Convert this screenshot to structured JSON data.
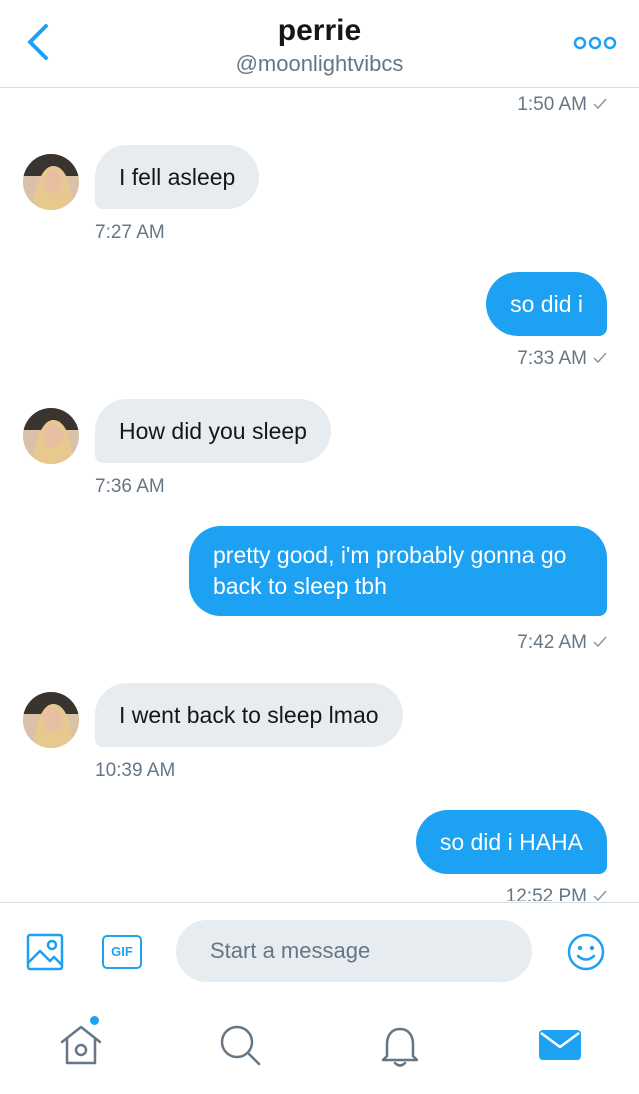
{
  "header": {
    "title": "perrie",
    "handle": "@moonlightvibcs"
  },
  "messages": [
    {
      "dir": "out_ts",
      "time": "1:50 AM"
    },
    {
      "dir": "in",
      "text": "I fell asleep",
      "time": "7:27 AM"
    },
    {
      "dir": "out",
      "text": "so did i",
      "time": "7:33 AM"
    },
    {
      "dir": "in",
      "text": "How did you sleep",
      "time": "7:36 AM"
    },
    {
      "dir": "out",
      "text": "pretty good, i'm probably gonna go back to sleep tbh",
      "time": "7:42 AM"
    },
    {
      "dir": "in",
      "text": "I went back to sleep lmao",
      "time": "10:39 AM"
    },
    {
      "dir": "out",
      "text": "so did i HAHA",
      "time": "12:52 PM"
    }
  ],
  "composer": {
    "gif_label": "GIF",
    "placeholder": "Start a message"
  },
  "colors": {
    "accent": "#1da1f2",
    "incoming_bubble": "#e6ecf0",
    "muted_text": "#657786"
  },
  "tabs": [
    "home-icon",
    "search-icon",
    "notifications-icon",
    "messages-icon"
  ]
}
